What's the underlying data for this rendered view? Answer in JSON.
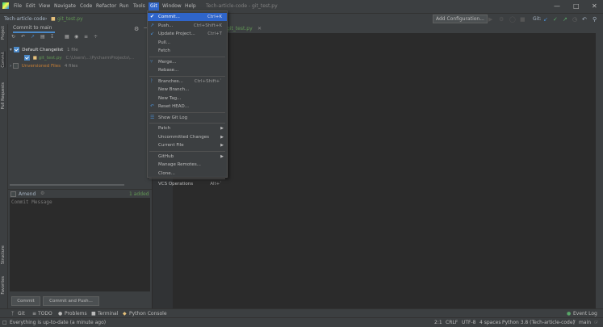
{
  "menu": {
    "items": [
      "File",
      "Edit",
      "View",
      "Navigate",
      "Code",
      "Refactor",
      "Run",
      "Tools",
      "Git",
      "Window",
      "Help"
    ],
    "window_title": "Tech-article-code - git_test.py"
  },
  "navbar": {
    "project": "Tech-article-code",
    "file": "git_test.py",
    "add_configuration": "Add Configuration...",
    "git_label": "Git:"
  },
  "left_tabs": [
    "Project",
    "Commit",
    "Pull Requests",
    "Structure",
    "Favorites"
  ],
  "commit_panel": {
    "tab_label": "Commit to main",
    "changelist_label": "Default Changelist",
    "changelist_count": "1 file",
    "file_name": "git_test.py",
    "file_path": "C:\\Users\\...\\PycharmProjects\\...",
    "unversioned_label": "Unversioned Files",
    "unversioned_count": "4 files",
    "amend_label": "Amend",
    "added_label": "1 added",
    "message_placeholder": "Commit Message",
    "commit_button": "Commit",
    "commit_push_button": "Commit and Push..."
  },
  "editor": {
    "tab_label": "git_test.py"
  },
  "git_menu": [
    {
      "label": "Commit...",
      "shortcut": "Ctrl+K",
      "icon": "check",
      "selected": true
    },
    {
      "label": "Push...",
      "shortcut": "Ctrl+Shift+K",
      "icon": "arrow-up-right"
    },
    {
      "label": "Update Project...",
      "shortcut": "Ctrl+T",
      "icon": "arrow-down-left"
    },
    {
      "label": "Pull...",
      "shortcut": ""
    },
    {
      "label": "Fetch",
      "shortcut": ""
    },
    {
      "sep": true
    },
    {
      "label": "Merge...",
      "shortcut": "",
      "icon": "merge"
    },
    {
      "label": "Rebase...",
      "shortcut": ""
    },
    {
      "sep": true
    },
    {
      "label": "Branches...",
      "shortcut": "Ctrl+Shift+`",
      "icon": "branch"
    },
    {
      "label": "New Branch...",
      "shortcut": ""
    },
    {
      "label": "New Tag...",
      "shortcut": ""
    },
    {
      "label": "Reset HEAD...",
      "shortcut": "",
      "icon": "undo"
    },
    {
      "sep": true
    },
    {
      "label": "Show Git Log",
      "shortcut": "",
      "icon": "log"
    },
    {
      "sep": true
    },
    {
      "label": "Patch",
      "submenu": true
    },
    {
      "label": "Uncommitted Changes",
      "submenu": true
    },
    {
      "label": "Current File",
      "submenu": true
    },
    {
      "sep": true
    },
    {
      "label": "GitHub",
      "submenu": true
    },
    {
      "label": "Manage Remotes..."
    },
    {
      "label": "Clone..."
    },
    {
      "sep": true
    },
    {
      "label": "VCS Operations",
      "shortcut": "Alt+`"
    }
  ],
  "bottom_tools": [
    "Git",
    "TODO",
    "Problems",
    "Terminal",
    "Python Console",
    "Event Log"
  ],
  "status": {
    "message": "Everything is up-to-date (a minute ago)",
    "position": "2:1",
    "line_sep": "CRLF",
    "encoding": "UTF-8",
    "indent": "4 spaces",
    "interpreter": "Python 3.8 (Tech-article-code)",
    "branch": "main"
  },
  "colors": {
    "accent": "#2f65ca",
    "panel": "#3c3f41",
    "editor": "#2b2b2b",
    "added": "#629755"
  }
}
